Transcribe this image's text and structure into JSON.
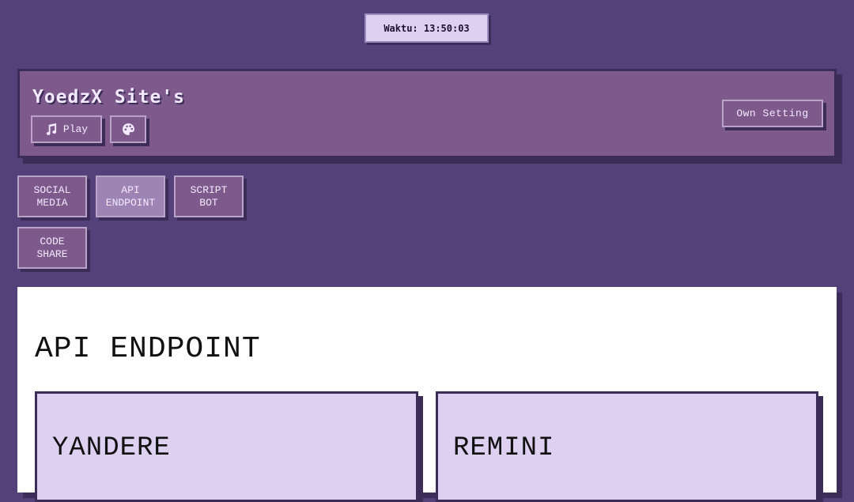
{
  "clock": {
    "text": "Waktu: 13:50:03"
  },
  "header": {
    "title": "YoedzX Site's",
    "play_label": "Play",
    "own_setting_label": "Own Setting",
    "icons": [
      "music-icon",
      "palette-icon"
    ]
  },
  "tabs": [
    {
      "label": "SOCIAL\nMEDIA",
      "active": false
    },
    {
      "label": "API\nENDPOINT",
      "active": true
    },
    {
      "label": "SCRIPT\nBOT",
      "active": false
    },
    {
      "label": "CODE\nSHARE",
      "active": false
    }
  ],
  "main": {
    "section_title": "API ENDPOINT",
    "cards": [
      {
        "name": "YANDERE"
      },
      {
        "name": "REMINI"
      }
    ]
  },
  "colors": {
    "background": "#54417a",
    "header": "#7e5a8c",
    "shadow": "#3b2c58",
    "card": "#ddd0f0",
    "active_tab": "#9d84b4"
  }
}
